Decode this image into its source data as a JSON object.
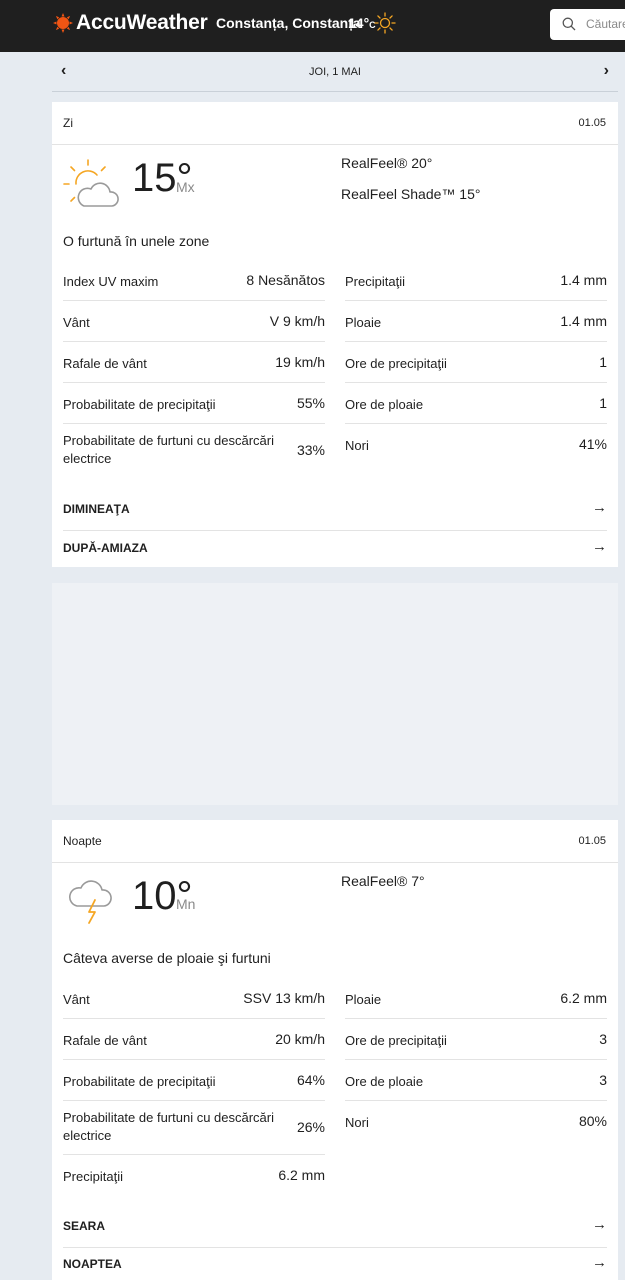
{
  "header": {
    "brand": "AccuWeather",
    "location": "Constanța, Constanța",
    "temp": "14°",
    "temp_unit": "C",
    "search_placeholder": "Căutare",
    "logo_icon": "sun-logo-icon",
    "weather_icon": "sun-icon",
    "colors": {
      "bar": "#1f1f1f",
      "accent": "#f05514",
      "sun": "#f5a623"
    }
  },
  "date_nav": {
    "prev": "‹",
    "date": "JOI, 1 MAI",
    "next": "›"
  },
  "day": {
    "label": "Zi",
    "date": "01.05",
    "icon": "partly-sunny-icon",
    "temp": "15°",
    "temp_label": "Mx",
    "realfeel": "RealFeel® 20°",
    "realfeel_shade": "RealFeel Shade™ 15°",
    "phrase": "O furtună în unele zone",
    "left": [
      {
        "k": "Index UV maxim",
        "v": "8 Nesănătos"
      },
      {
        "k": "Vânt",
        "v": "V 9 km/h"
      },
      {
        "k": "Rafale de vânt",
        "v": "19 km/h"
      },
      {
        "k": "Probabilitate de precipitaţii",
        "v": "55%"
      },
      {
        "k": "Probabilitate de furtuni cu descărcări electrice",
        "v": "33%"
      }
    ],
    "right": [
      {
        "k": "Precipitaţii",
        "v": "1.4 mm"
      },
      {
        "k": "Ploaie",
        "v": "1.4 mm"
      },
      {
        "k": "Ore de precipitaţii",
        "v": "1"
      },
      {
        "k": "Ore de ploaie",
        "v": "1"
      },
      {
        "k": "Nori",
        "v": "41%"
      }
    ],
    "links": [
      "DIMINEAŢA",
      "DUPĂ-AMIAZA"
    ],
    "arrow": "→"
  },
  "night": {
    "label": "Noapte",
    "date": "01.05",
    "icon": "thunderstorm-icon",
    "temp": "10°",
    "temp_label": "Mn",
    "realfeel": "RealFeel® 7°",
    "phrase": "Câteva averse de ploaie şi furtuni",
    "left": [
      {
        "k": "Vânt",
        "v": "SSV 13 km/h"
      },
      {
        "k": "Rafale de vânt",
        "v": "20 km/h"
      },
      {
        "k": "Probabilitate de precipitaţii",
        "v": "64%"
      },
      {
        "k": "Probabilitate de furtuni cu descărcări electrice",
        "v": "26%"
      },
      {
        "k": "Precipitaţii",
        "v": "6.2 mm"
      }
    ],
    "right": [
      {
        "k": "Ploaie",
        "v": "6.2 mm"
      },
      {
        "k": "Ore de precipitaţii",
        "v": "3"
      },
      {
        "k": "Ore de ploaie",
        "v": "3"
      },
      {
        "k": "Nori",
        "v": "80%"
      }
    ],
    "links": [
      "SEARA",
      "NOAPTEA"
    ],
    "arrow": "→"
  }
}
